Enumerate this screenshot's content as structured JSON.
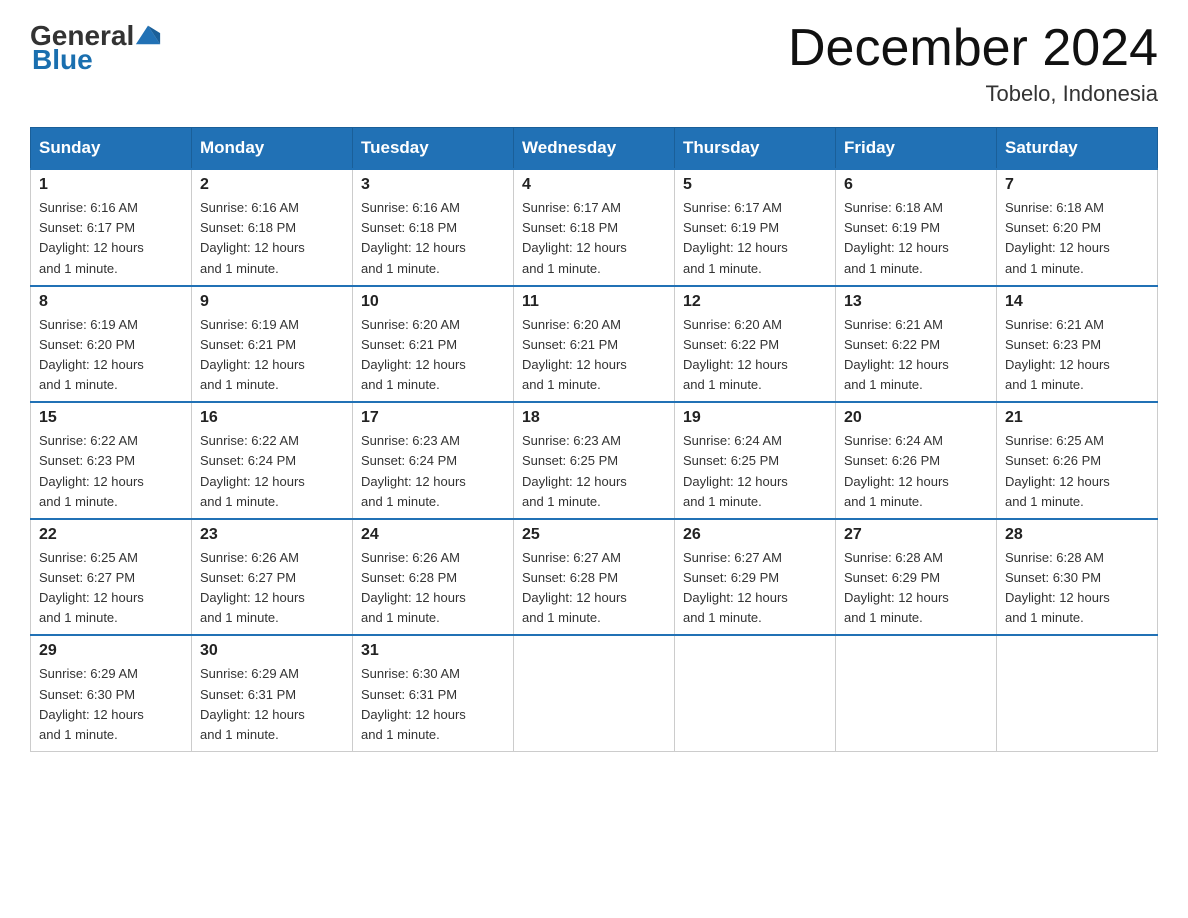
{
  "header": {
    "logo_general": "General",
    "logo_blue": "Blue",
    "month_year": "December 2024",
    "location": "Tobelo, Indonesia"
  },
  "weekdays": [
    "Sunday",
    "Monday",
    "Tuesday",
    "Wednesday",
    "Thursday",
    "Friday",
    "Saturday"
  ],
  "weeks": [
    [
      {
        "day": "1",
        "sunrise": "6:16 AM",
        "sunset": "6:17 PM",
        "daylight": "12 hours and 1 minute."
      },
      {
        "day": "2",
        "sunrise": "6:16 AM",
        "sunset": "6:18 PM",
        "daylight": "12 hours and 1 minute."
      },
      {
        "day": "3",
        "sunrise": "6:16 AM",
        "sunset": "6:18 PM",
        "daylight": "12 hours and 1 minute."
      },
      {
        "day": "4",
        "sunrise": "6:17 AM",
        "sunset": "6:18 PM",
        "daylight": "12 hours and 1 minute."
      },
      {
        "day": "5",
        "sunrise": "6:17 AM",
        "sunset": "6:19 PM",
        "daylight": "12 hours and 1 minute."
      },
      {
        "day": "6",
        "sunrise": "6:18 AM",
        "sunset": "6:19 PM",
        "daylight": "12 hours and 1 minute."
      },
      {
        "day": "7",
        "sunrise": "6:18 AM",
        "sunset": "6:20 PM",
        "daylight": "12 hours and 1 minute."
      }
    ],
    [
      {
        "day": "8",
        "sunrise": "6:19 AM",
        "sunset": "6:20 PM",
        "daylight": "12 hours and 1 minute."
      },
      {
        "day": "9",
        "sunrise": "6:19 AM",
        "sunset": "6:21 PM",
        "daylight": "12 hours and 1 minute."
      },
      {
        "day": "10",
        "sunrise": "6:20 AM",
        "sunset": "6:21 PM",
        "daylight": "12 hours and 1 minute."
      },
      {
        "day": "11",
        "sunrise": "6:20 AM",
        "sunset": "6:21 PM",
        "daylight": "12 hours and 1 minute."
      },
      {
        "day": "12",
        "sunrise": "6:20 AM",
        "sunset": "6:22 PM",
        "daylight": "12 hours and 1 minute."
      },
      {
        "day": "13",
        "sunrise": "6:21 AM",
        "sunset": "6:22 PM",
        "daylight": "12 hours and 1 minute."
      },
      {
        "day": "14",
        "sunrise": "6:21 AM",
        "sunset": "6:23 PM",
        "daylight": "12 hours and 1 minute."
      }
    ],
    [
      {
        "day": "15",
        "sunrise": "6:22 AM",
        "sunset": "6:23 PM",
        "daylight": "12 hours and 1 minute."
      },
      {
        "day": "16",
        "sunrise": "6:22 AM",
        "sunset": "6:24 PM",
        "daylight": "12 hours and 1 minute."
      },
      {
        "day": "17",
        "sunrise": "6:23 AM",
        "sunset": "6:24 PM",
        "daylight": "12 hours and 1 minute."
      },
      {
        "day": "18",
        "sunrise": "6:23 AM",
        "sunset": "6:25 PM",
        "daylight": "12 hours and 1 minute."
      },
      {
        "day": "19",
        "sunrise": "6:24 AM",
        "sunset": "6:25 PM",
        "daylight": "12 hours and 1 minute."
      },
      {
        "day": "20",
        "sunrise": "6:24 AM",
        "sunset": "6:26 PM",
        "daylight": "12 hours and 1 minute."
      },
      {
        "day": "21",
        "sunrise": "6:25 AM",
        "sunset": "6:26 PM",
        "daylight": "12 hours and 1 minute."
      }
    ],
    [
      {
        "day": "22",
        "sunrise": "6:25 AM",
        "sunset": "6:27 PM",
        "daylight": "12 hours and 1 minute."
      },
      {
        "day": "23",
        "sunrise": "6:26 AM",
        "sunset": "6:27 PM",
        "daylight": "12 hours and 1 minute."
      },
      {
        "day": "24",
        "sunrise": "6:26 AM",
        "sunset": "6:28 PM",
        "daylight": "12 hours and 1 minute."
      },
      {
        "day": "25",
        "sunrise": "6:27 AM",
        "sunset": "6:28 PM",
        "daylight": "12 hours and 1 minute."
      },
      {
        "day": "26",
        "sunrise": "6:27 AM",
        "sunset": "6:29 PM",
        "daylight": "12 hours and 1 minute."
      },
      {
        "day": "27",
        "sunrise": "6:28 AM",
        "sunset": "6:29 PM",
        "daylight": "12 hours and 1 minute."
      },
      {
        "day": "28",
        "sunrise": "6:28 AM",
        "sunset": "6:30 PM",
        "daylight": "12 hours and 1 minute."
      }
    ],
    [
      {
        "day": "29",
        "sunrise": "6:29 AM",
        "sunset": "6:30 PM",
        "daylight": "12 hours and 1 minute."
      },
      {
        "day": "30",
        "sunrise": "6:29 AM",
        "sunset": "6:31 PM",
        "daylight": "12 hours and 1 minute."
      },
      {
        "day": "31",
        "sunrise": "6:30 AM",
        "sunset": "6:31 PM",
        "daylight": "12 hours and 1 minute."
      },
      null,
      null,
      null,
      null
    ]
  ]
}
